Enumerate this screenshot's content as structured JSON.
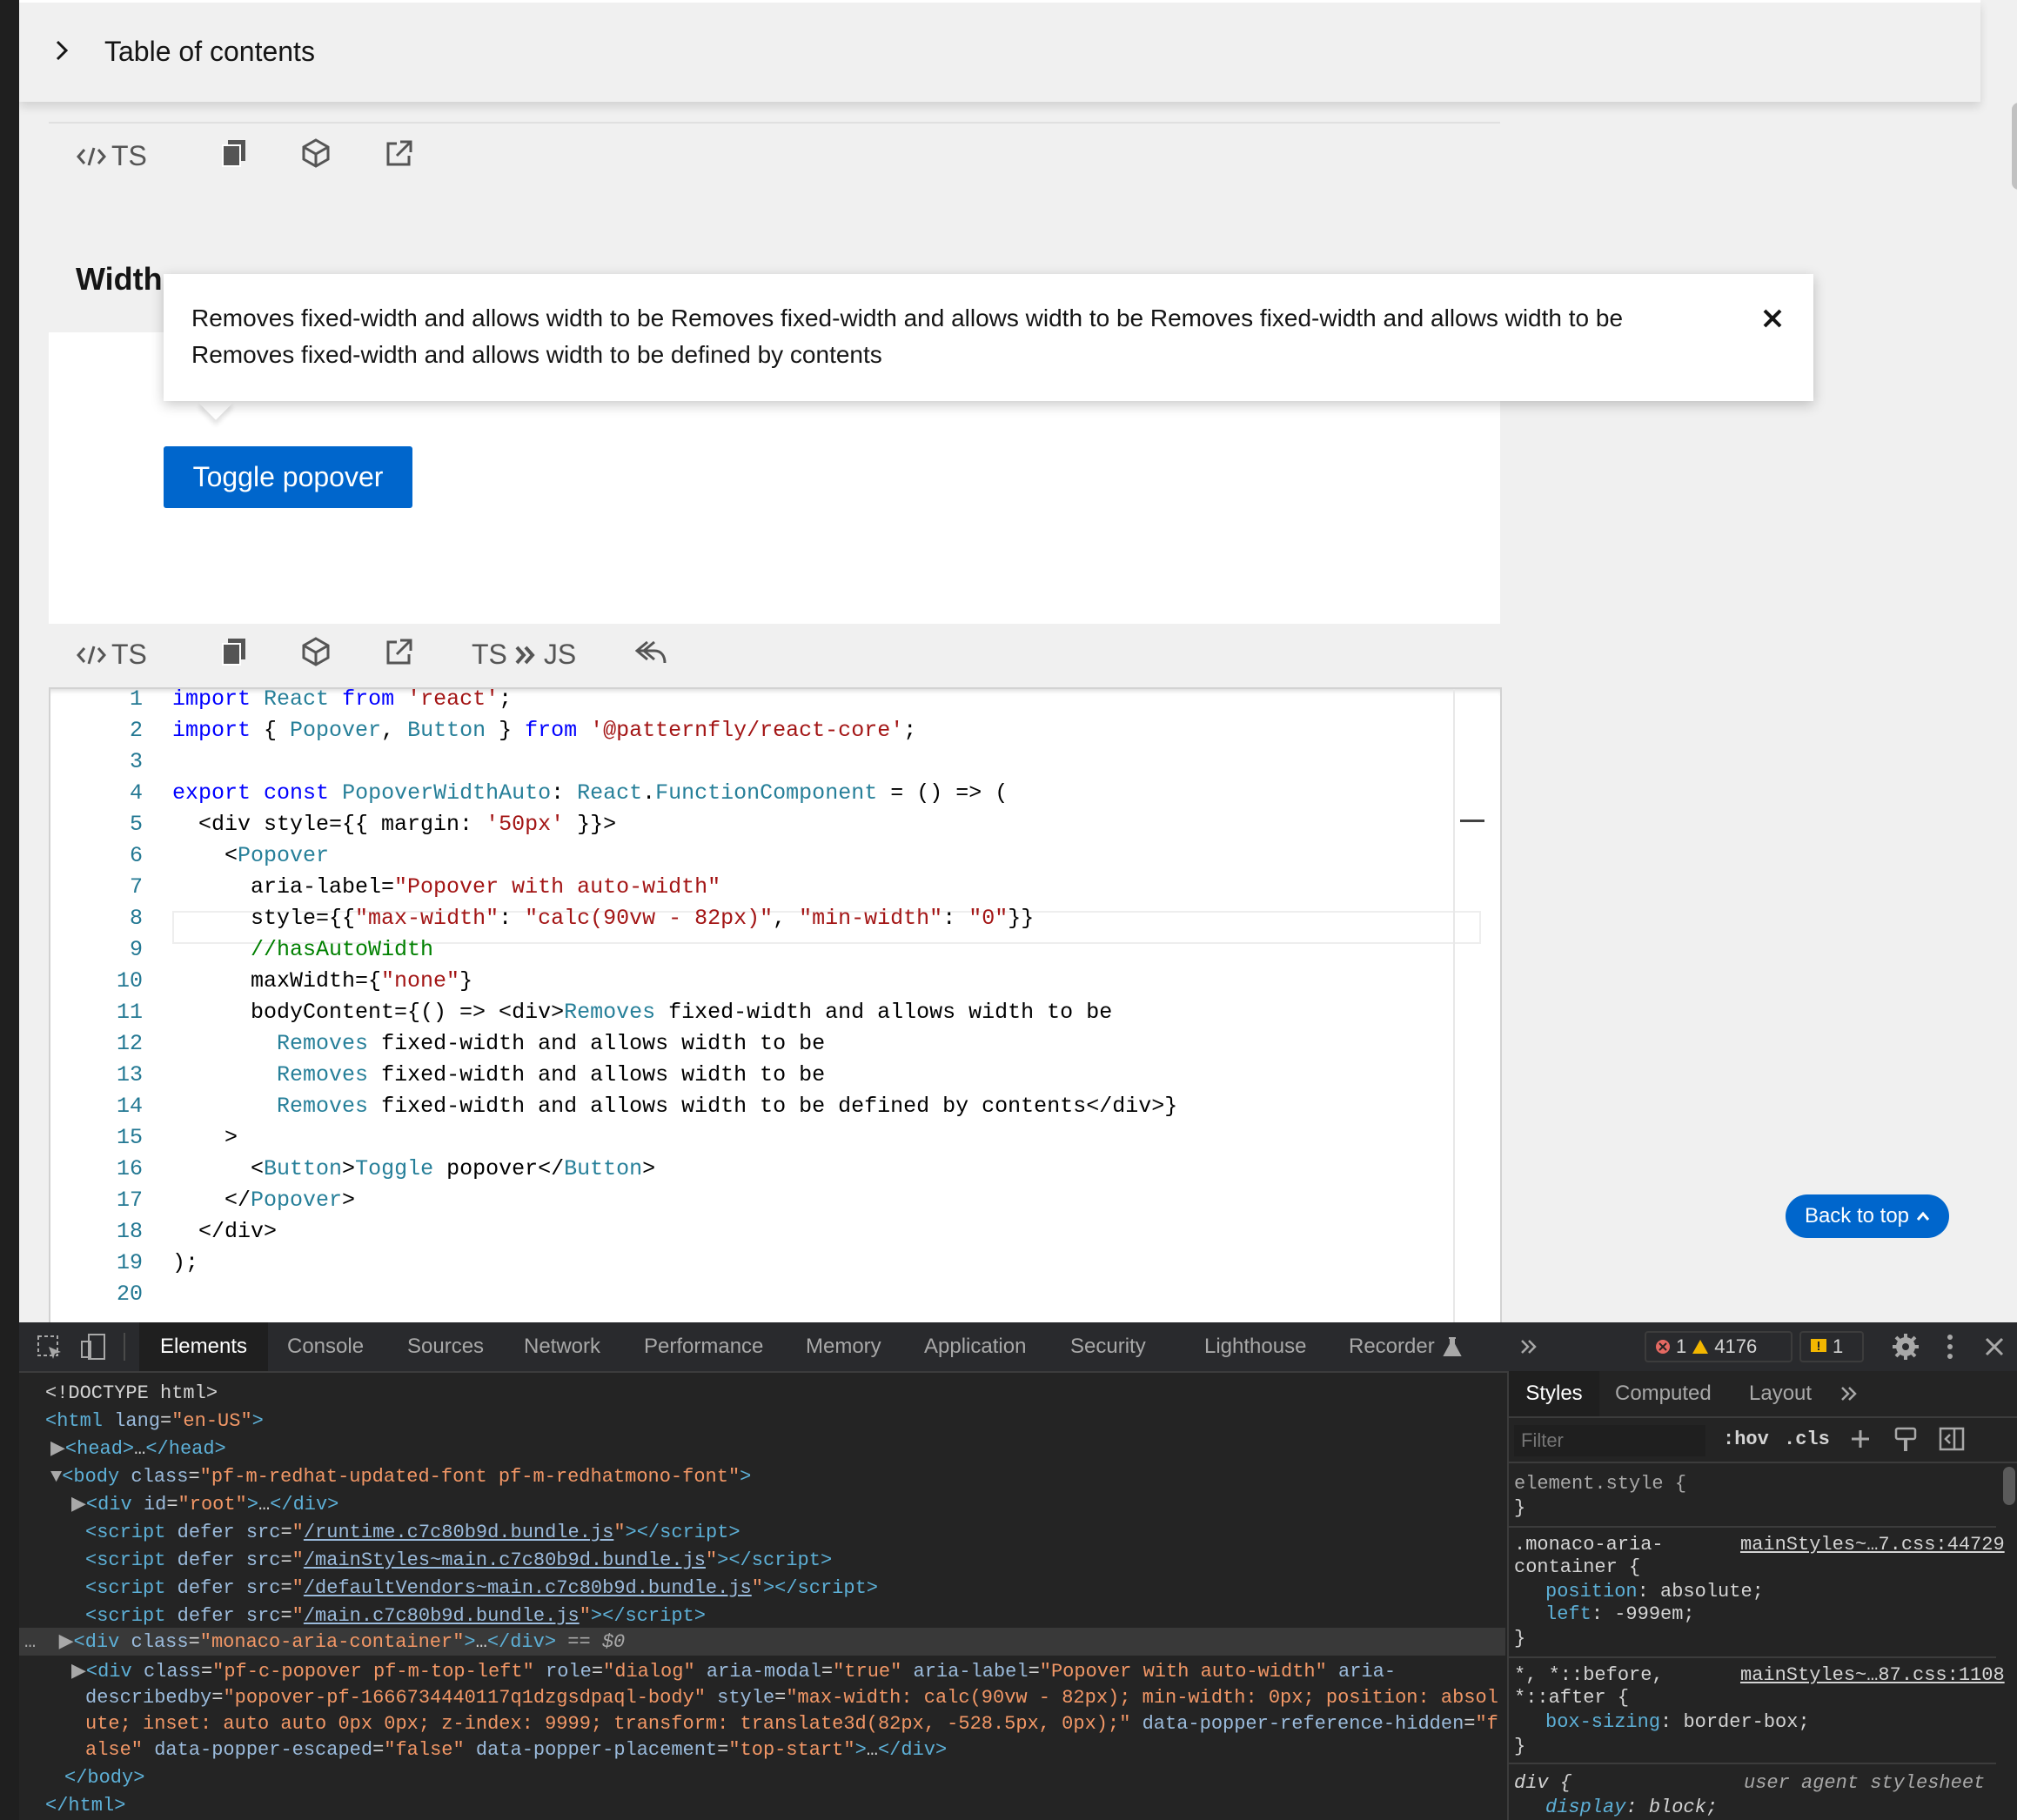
{
  "toc": {
    "label": "Table of contents"
  },
  "toolbar1": {
    "ts_label": "TS"
  },
  "example": {
    "heading": "Width"
  },
  "popover": {
    "line1": "Removes fixed-width and allows width to be Removes fixed-width and allows width to be Removes fixed-width and allows width to be",
    "line2": "Removes fixed-width and allows width to be defined by contents"
  },
  "toggle_button": "Toggle popover",
  "toolbar2": {
    "ts_label": "TS",
    "ts_js_ts": "TS",
    "ts_js_js": "JS"
  },
  "code_lines": [
    {
      "n": "1"
    },
    {
      "n": "2"
    },
    {
      "n": "3"
    },
    {
      "n": "4"
    },
    {
      "n": "5"
    },
    {
      "n": "6"
    },
    {
      "n": "7"
    },
    {
      "n": "8"
    },
    {
      "n": "9"
    },
    {
      "n": "10"
    },
    {
      "n": "11"
    },
    {
      "n": "12"
    },
    {
      "n": "13"
    },
    {
      "n": "14"
    },
    {
      "n": "15"
    },
    {
      "n": "16"
    },
    {
      "n": "17"
    },
    {
      "n": "18"
    },
    {
      "n": "19"
    },
    {
      "n": "20"
    }
  ],
  "back_to_top": "Back to top",
  "devtools": {
    "tabs": [
      "Elements",
      "Console",
      "Sources",
      "Network",
      "Performance",
      "Memory",
      "Application",
      "Security",
      "Lighthouse",
      "Recorder"
    ],
    "errors": "1",
    "warnings": "4176",
    "info": "1",
    "styles_tabs": [
      "Styles",
      "Computed",
      "Layout"
    ],
    "filter_placeholder": "Filter",
    "hov": ":hov",
    "cls": ".cls",
    "dom": {
      "doctype": "<!DOCTYPE html>",
      "selected_suffix": "== $0"
    },
    "styles": {
      "element_style": "element.style {",
      "rule1_selector_a": ".monaco-aria-",
      "rule1_selector_b": "container {",
      "rule1_source": "mainStyles~…7.css:44729",
      "rule1_prop1": "position",
      "rule1_val1": "absolute;",
      "rule1_prop2": "left",
      "rule1_val2": "-999em;",
      "rule2_selector_a": "*, *::before,",
      "rule2_selector_b": "*::after {",
      "rule2_source": "mainStyles~…87.css:1108",
      "rule2_prop1": "box-sizing",
      "rule2_val1": "border-box;",
      "rule3_selector": "div {",
      "rule3_source": "user agent stylesheet",
      "rule3_prop1": "display",
      "rule3_val1": "block;"
    }
  },
  "colors": {
    "accent": "#0066cc",
    "devtools_bg": "#242424"
  }
}
